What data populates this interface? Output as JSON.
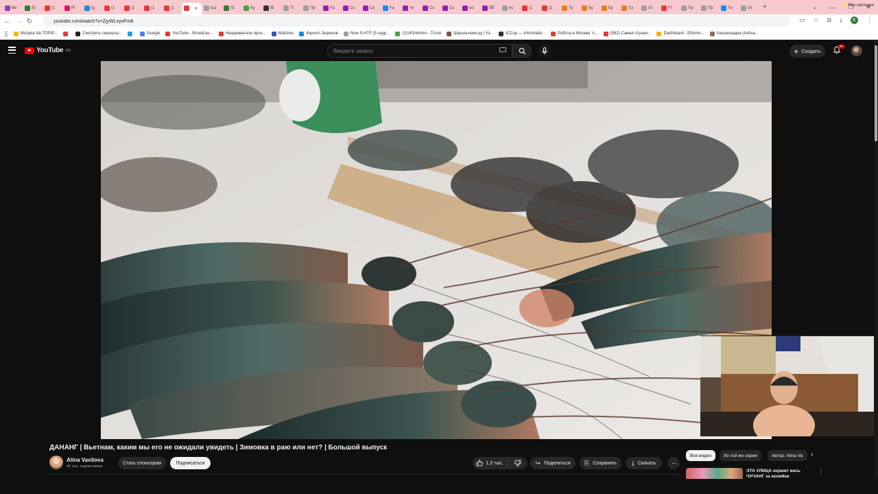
{
  "browser": {
    "tabs": [
      {
        "label": "Ве",
        "color": "#8e44ad"
      },
      {
        "label": "St",
        "color": "#2e7d32"
      },
      {
        "label": "(1",
        "color": "#e53935"
      },
      {
        "label": "Pr",
        "color": "#d81b60"
      },
      {
        "label": "Ig",
        "color": "#1e88e5"
      },
      {
        "label": "(1",
        "color": "#e53935"
      },
      {
        "label": "(1",
        "color": "#e53935"
      },
      {
        "label": "(1",
        "color": "#e53935"
      },
      {
        "label": "(1",
        "color": "#e53935"
      },
      {
        "label": "",
        "color": "#e53935",
        "active": true
      },
      {
        "label": "Ga",
        "color": "#9e9e9e"
      },
      {
        "label": "St",
        "color": "#2e7d32"
      },
      {
        "label": "Ку",
        "color": "#43a047"
      },
      {
        "label": "Bi",
        "color": "#333333"
      },
      {
        "label": "Tr",
        "color": "#9e9e9e"
      },
      {
        "label": "Пр",
        "color": "#9e9e9e"
      },
      {
        "label": "Fa",
        "color": "#8e24aa"
      },
      {
        "label": "Ск",
        "color": "#8e24aa"
      },
      {
        "label": "Ск",
        "color": "#8e24aa"
      },
      {
        "label": "Fa",
        "color": "#1e88e5"
      },
      {
        "label": "те",
        "color": "#8e24aa"
      },
      {
        "label": "Ск",
        "color": "#8e24aa"
      },
      {
        "label": "Ск",
        "color": "#8e24aa"
      },
      {
        "label": "ео",
        "color": "#8e24aa"
      },
      {
        "label": "ВЕ",
        "color": "#8e24aa"
      },
      {
        "label": "ec",
        "color": "#9e9e9e"
      },
      {
        "label": "(1",
        "color": "#e53935"
      },
      {
        "label": "(1",
        "color": "#e53935"
      },
      {
        "label": "Ту",
        "color": "#e67e22"
      },
      {
        "label": "Бу",
        "color": "#e67e22"
      },
      {
        "label": "Бу",
        "color": "#e67e22"
      },
      {
        "label": "Хэ",
        "color": "#e67e22"
      },
      {
        "label": "Gr",
        "color": "#9e9e9e"
      },
      {
        "label": "Fi",
        "color": "#e53935"
      },
      {
        "label": "Пр",
        "color": "#9e9e9e"
      },
      {
        "label": "Пр",
        "color": "#9e9e9e"
      },
      {
        "label": "Yo",
        "color": "#1e88e5"
      },
      {
        "label": "Gr",
        "color": "#9e9e9e"
      }
    ],
    "url": "youtube.com/watch?v=ZjyWLxyvFm8",
    "profile_letter": "K",
    "bookmarks": [
      {
        "label": "Muzyka Na TOPIE...",
        "color": "#f4b400"
      },
      {
        "label": "",
        "color": "#e53935"
      },
      {
        "label": "Смотреть сериалы...",
        "color": "#222222"
      },
      {
        "label": "",
        "color": "#1da1f2"
      },
      {
        "label": "Google",
        "color": "#4285f4"
      },
      {
        "label": "YouTube - Broadcas...",
        "color": "#e53935"
      },
      {
        "label": "Неадекватное прох...",
        "color": "#e53935"
      },
      {
        "label": "Matches",
        "color": "#3f51b5"
      },
      {
        "label": "Кирилл Зыренов",
        "color": "#1e88e5"
      },
      {
        "label": "Now 5-HTP (5-гидр...",
        "color": "#9e9e9e"
      },
      {
        "label": "(1)VKInkHoro - Trooo",
        "color": "#43a047"
      },
      {
        "label": "Шашлычник.ру | Уз...",
        "color": "#795548"
      },
      {
        "label": "ICCup — Informatio...",
        "color": "#333333"
      },
      {
        "label": "Работа в Москве: п...",
        "color": "#e53935"
      },
      {
        "label": "(562) Самая странн...",
        "color": "#e53935"
      },
      {
        "label": "Dashboard - Ethorm...",
        "color": "#f4b400"
      },
      {
        "label": "Ашшанзадка (Ashva...",
        "color": "#8d6e63"
      }
    ],
    "all_bookmarks_label": "Все закладки"
  },
  "youtube": {
    "logo_text": "YouTube",
    "region": "RU",
    "search_placeholder": "Введите запрос",
    "create_label": "Создать",
    "notification_badge": "9+"
  },
  "video": {
    "title": "ДАНАНГ | Вьетнам, каким мы его не ожидали увидеть | Зимовка в раю или нет? | Большой выпуск",
    "channel_name": "Alina Vavilova",
    "subscribers": "46 тыс. подписчиков",
    "sponsor_label": "Стать спонсором",
    "subscribe_label": "Подписаться",
    "likes": "1,3 тыс.",
    "share_label": "Поделиться",
    "save_label": "Сохранить",
    "download_label": "Скачать"
  },
  "sidebar": {
    "chips": [
      {
        "label": "Все видео",
        "active": true
      },
      {
        "label": "Из той же серии",
        "active": false
      },
      {
        "label": "Автор: Alina Va",
        "active": false
      }
    ],
    "recommendation_title": "ЭТА УЛИЦА кормит весь ЧУЧАНГ за копейки"
  }
}
